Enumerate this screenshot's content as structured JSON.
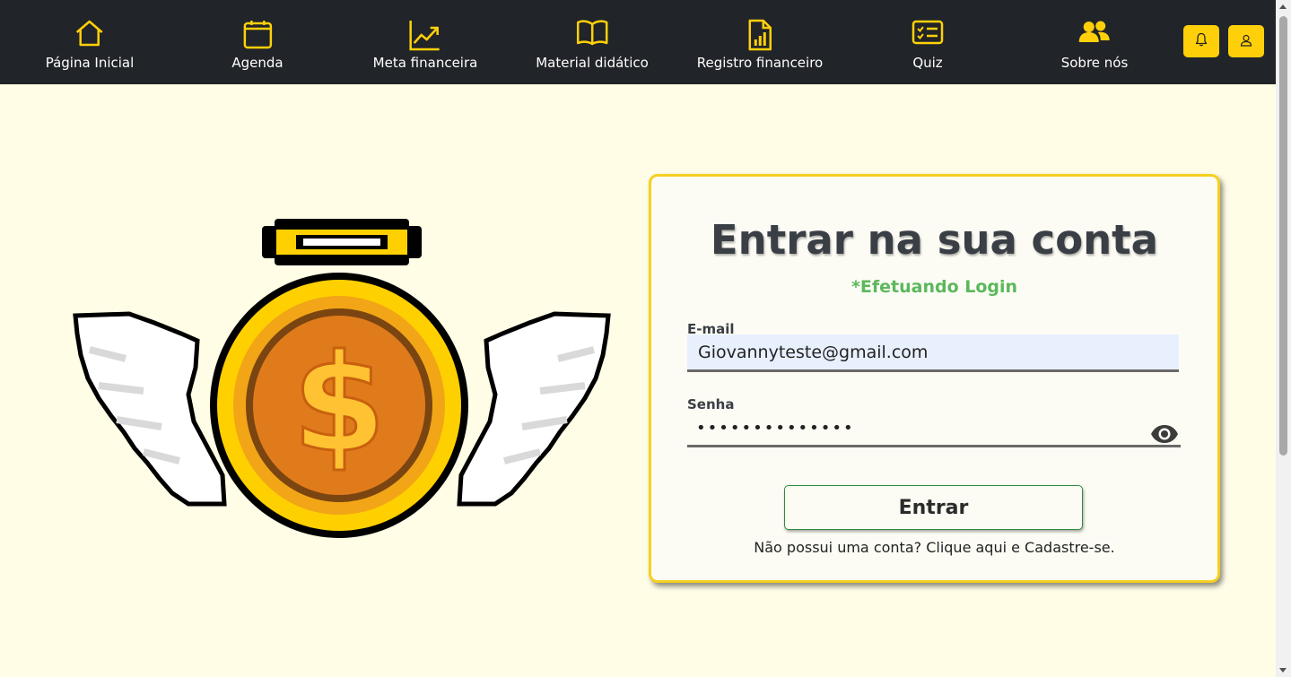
{
  "nav": {
    "items": [
      {
        "label": "Página Inicial",
        "icon": "home-icon"
      },
      {
        "label": "Agenda",
        "icon": "calendar-icon"
      },
      {
        "label": "Meta financeira",
        "icon": "trend-chart-icon"
      },
      {
        "label": "Material didático",
        "icon": "book-icon"
      },
      {
        "label": "Registro financeiro",
        "icon": "report-file-icon"
      },
      {
        "label": "Quiz",
        "icon": "checklist-icon"
      },
      {
        "label": "Sobre nós",
        "icon": "users-icon"
      }
    ],
    "notification_icon": "bell-icon",
    "profile_icon": "user-icon"
  },
  "login": {
    "title": "Entrar na sua conta",
    "subtitle": "*Efetuando Login",
    "email_label": "E-mail",
    "email_value": "Giovannyteste@gmail.com",
    "password_label": "Senha",
    "password_value": "••••••••••••••",
    "show_password_icon": "eye-icon",
    "submit_label": "Entrar",
    "signup_text": "Não possui uma conta? Clique aqui e Cadastre-se."
  },
  "illustration": {
    "name": "winged-coin-illustration",
    "symbol": "$"
  },
  "colors": {
    "navbar": "#212428",
    "accent_yellow": "#ffd00a",
    "page_background": "#fffde6",
    "card_border": "#f5d020",
    "subtitle_green": "#5cb85c",
    "input_fill": "#e8f0fe"
  }
}
